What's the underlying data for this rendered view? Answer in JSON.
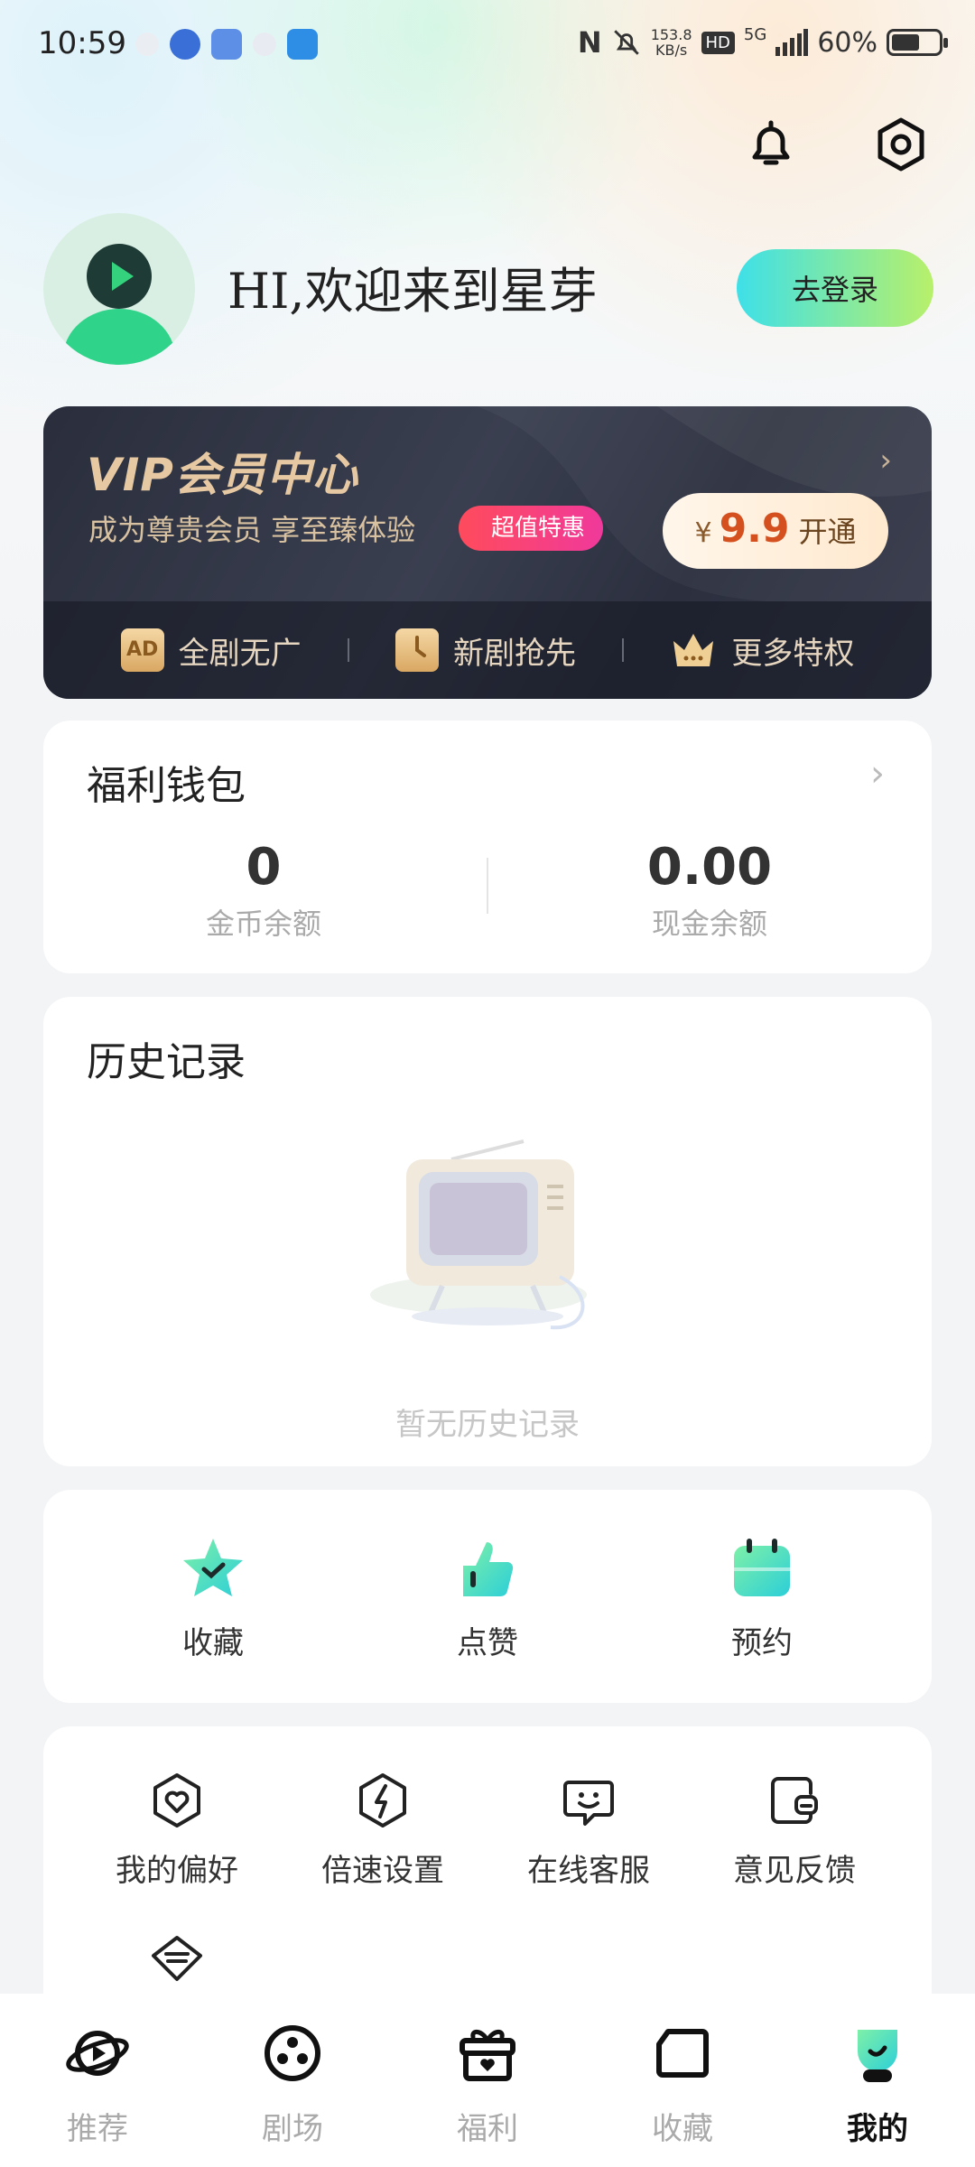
{
  "status_bar": {
    "time": "10:59",
    "net_speed_value": "153.8",
    "net_speed_unit": "KB/s",
    "hd_label": "HD",
    "network": "5G",
    "battery_text": "60%",
    "battery_level": 0.6
  },
  "profile": {
    "greeting": "HI,欢迎来到星芽",
    "login_label": "去登录"
  },
  "vip": {
    "title": "VIP会员中心",
    "subtitle": "成为尊贵会员 享至臻体验",
    "badge": "超值特惠",
    "currency": "¥",
    "price": "9.9",
    "open_label": "开通",
    "features": [
      {
        "icon": "ad-free-icon",
        "label": "全剧无广"
      },
      {
        "icon": "early-access-icon",
        "label": "新剧抢先"
      },
      {
        "icon": "crown-icon",
        "label": "更多特权"
      }
    ]
  },
  "wallet": {
    "title": "福利钱包",
    "coins_value": "0",
    "coins_label": "金币余额",
    "cash_value": "0.00",
    "cash_label": "现金余额"
  },
  "history": {
    "title": "历史记录",
    "empty_text": "暂无历史记录"
  },
  "quick_actions": [
    {
      "icon": "star-check-icon",
      "label": "收藏"
    },
    {
      "icon": "thumbs-up-icon",
      "label": "点赞"
    },
    {
      "icon": "calendar-icon",
      "label": "预约"
    }
  ],
  "tools": [
    {
      "icon": "heart-shield-icon",
      "label": "我的偏好"
    },
    {
      "icon": "speed-icon",
      "label": "倍速设置"
    },
    {
      "icon": "customer-service-icon",
      "label": "在线客服"
    },
    {
      "icon": "feedback-icon",
      "label": "意见反馈"
    }
  ],
  "bottom_nav": [
    {
      "icon": "planet-icon",
      "label": "推荐",
      "active": false
    },
    {
      "icon": "film-reel-icon",
      "label": "剧场",
      "active": false
    },
    {
      "icon": "gift-icon",
      "label": "福利",
      "active": false
    },
    {
      "icon": "folder-icon",
      "label": "收藏",
      "active": false
    },
    {
      "icon": "profile-icon",
      "label": "我的",
      "active": true
    }
  ],
  "colors": {
    "accent_green": "#2fd389",
    "login_gradient_start": "#3ee0e8",
    "login_gradient_end": "#b8f06a",
    "vip_badge": "#ff4b5c",
    "price": "#d5501f"
  }
}
